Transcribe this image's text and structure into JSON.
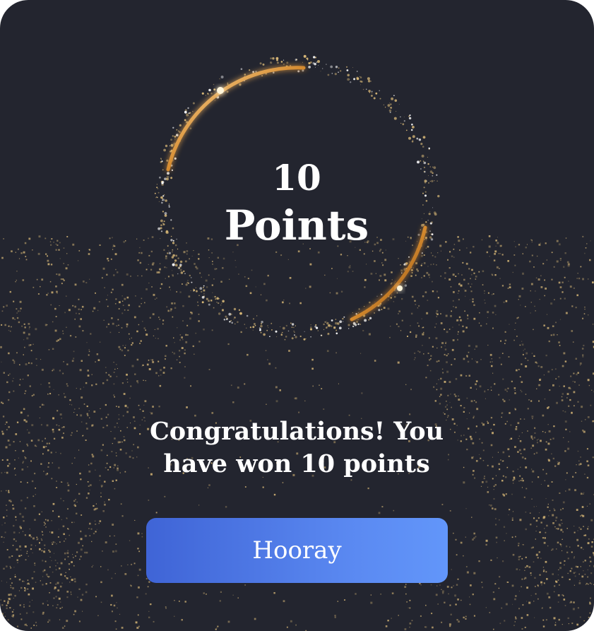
{
  "reward": {
    "points_value": "10",
    "points_label": "Points"
  },
  "message": "Congratulations! You have won 10 points",
  "action": {
    "label": "Hooray"
  },
  "colors": {
    "background": "#23252f",
    "gold": "#d8b877",
    "button_start": "#3f64d6",
    "button_end": "#6296fa",
    "text": "#ffffff"
  }
}
